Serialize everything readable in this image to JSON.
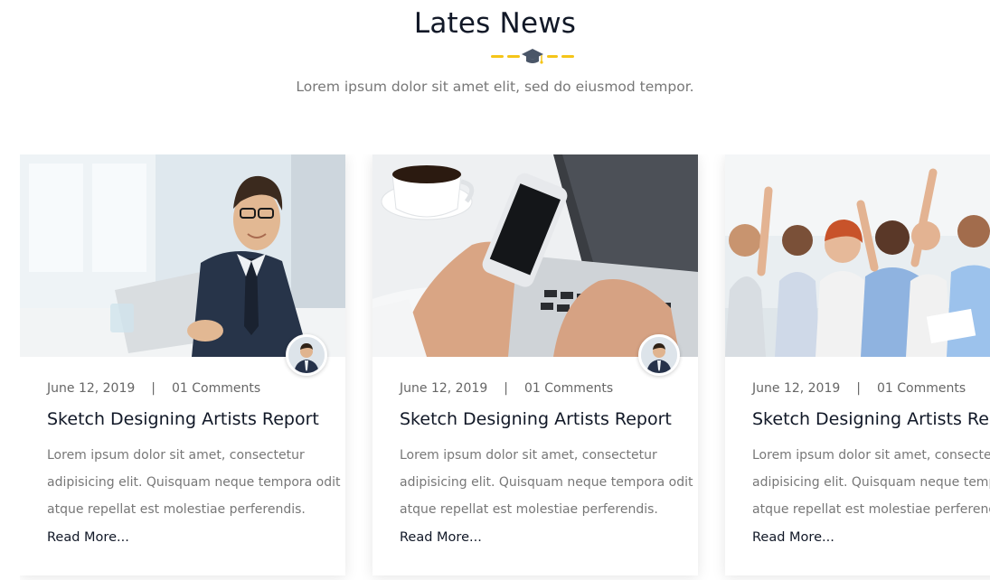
{
  "section": {
    "title": "Lates News",
    "subtitle": "Lorem ipsum dolor sit amet elit, sed do eiusmod tempor.",
    "divider_icon": "graduation-cap-icon",
    "accent_color": "#f5c518"
  },
  "cards": [
    {
      "image": "man-at-laptop-photo",
      "date": "June 12, 2019",
      "separator": "|",
      "comments": "01 Comments",
      "title": "Sketch Designing Artists Report",
      "excerpt": [
        "Lorem ipsum dolor sit amet, consectetur",
        "adipisicing elit. Quisquam neque tempora odit",
        "atque repellat est molestiae perferendis."
      ],
      "read_more": "Read More..."
    },
    {
      "image": "phone-and-laptop-photo",
      "date": "June 12, 2019",
      "separator": "|",
      "comments": "01 Comments",
      "title": "Sketch Designing Artists Report",
      "excerpt": [
        "Lorem ipsum dolor sit amet, consectetur",
        "adipisicing elit. Quisquam neque tempora odit",
        "atque repellat est molestiae perferendis."
      ],
      "read_more": "Read More..."
    },
    {
      "image": "team-celebrating-photo",
      "date": "June 12, 2019",
      "separator": "|",
      "comments": "01 Comments",
      "title": "Sketch Designing Artists Report",
      "excerpt": [
        "Lorem ipsum dolor sit amet, consectetur",
        "adipisicing elit. Quisquam neque tempora odit",
        "atque repellat est molestiae perferendis."
      ],
      "read_more": "Read More..."
    }
  ]
}
